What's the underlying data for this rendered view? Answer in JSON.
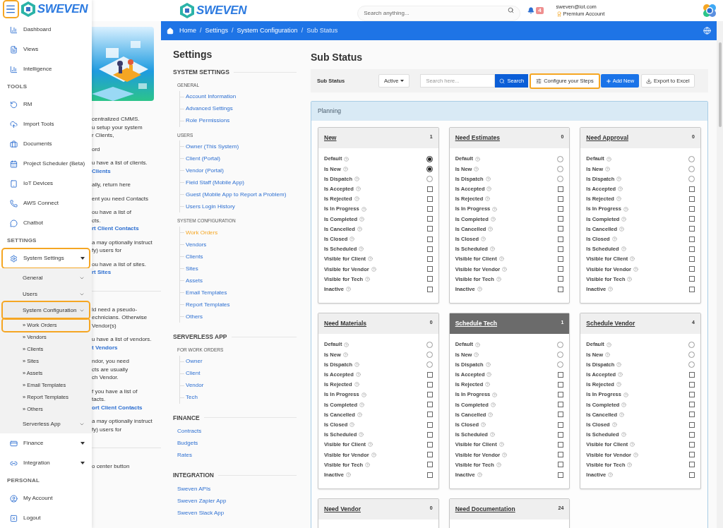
{
  "sidebar": {
    "menu_button": {
      "highlighted": true
    },
    "logo": "SWEVEN",
    "items": [
      {
        "kind": "link",
        "label": "Dashboard",
        "highlighted": false
      },
      {
        "kind": "link",
        "label": "Views",
        "highlighted": false
      },
      {
        "kind": "link",
        "label": "Intelligence",
        "highlighted": false
      },
      {
        "kind": "heading",
        "label": "TOOLS"
      },
      {
        "kind": "link",
        "label": "RM",
        "highlighted": false
      },
      {
        "kind": "link",
        "label": "Import Tools",
        "highlighted": false
      },
      {
        "kind": "link",
        "label": "Documents",
        "highlighted": false
      },
      {
        "kind": "link",
        "label": "Project Scheduler (Beta)",
        "highlighted": false
      },
      {
        "kind": "link",
        "label": "IoT Devices",
        "highlighted": false
      },
      {
        "kind": "link",
        "label": "AWS Connect",
        "highlighted": false
      },
      {
        "kind": "link",
        "label": "Chatbot",
        "highlighted": false
      },
      {
        "kind": "heading",
        "label": "SETTINGS"
      },
      {
        "kind": "group",
        "label": "System Settings",
        "highlighted": true,
        "expanded": true,
        "children": [
          {
            "kind": "group",
            "label": "General",
            "highlighted": false
          },
          {
            "kind": "group",
            "label": "Users",
            "highlighted": false
          },
          {
            "kind": "group",
            "label": "System Configuration",
            "highlighted": true,
            "expanded": true,
            "children": [
              {
                "kind": "link",
                "label": "» Work Orders",
                "highlighted": true
              },
              {
                "kind": "link",
                "label": "» Vendors",
                "highlighted": false
              },
              {
                "kind": "link",
                "label": "» Clients",
                "highlighted": false
              },
              {
                "kind": "link",
                "label": "» Sites",
                "highlighted": false
              },
              {
                "kind": "link",
                "label": "» Assets",
                "highlighted": false
              },
              {
                "kind": "link",
                "label": "» Email Templates",
                "highlighted": false
              },
              {
                "kind": "link",
                "label": "» Report Templates",
                "highlighted": false
              },
              {
                "kind": "link",
                "label": "» Others",
                "highlighted": false
              }
            ]
          },
          {
            "kind": "group",
            "label": "Serverless App",
            "highlighted": false
          }
        ]
      },
      {
        "kind": "group",
        "label": "Finance",
        "highlighted": false
      },
      {
        "kind": "group",
        "label": "Integration",
        "highlighted": false
      },
      {
        "kind": "heading",
        "label": "PERSONAL"
      },
      {
        "kind": "link",
        "label": "My Account",
        "highlighted": false
      },
      {
        "kind": "link",
        "label": "Logout",
        "highlighted": false
      }
    ]
  },
  "background_panel": {
    "sections": [
      [
        [
          {
            "kind": "text",
            "text": "centralized CMMS."
          },
          {
            "kind": "text",
            "text": "u setup your system"
          },
          {
            "kind": "text",
            "text": "r Clients,"
          }
        ],
        [
          {
            "kind": "text",
            "text": "ord"
          }
        ],
        [
          {
            "kind": "text",
            "text": "u have a list of clients."
          },
          {
            "kind": "link",
            "text": "Clients"
          }
        ],
        [
          {
            "kind": "text",
            "text": "ally, return here"
          }
        ],
        [
          {
            "kind": "text",
            "text": "ent you need Contacts"
          }
        ],
        [
          {
            "kind": "text",
            "text": "ou have a list of"
          },
          {
            "kind": "text",
            "text": "cts."
          },
          {
            "kind": "link",
            "text": "rt Client Contacts"
          }
        ],
        [
          {
            "kind": "text",
            "text": "a may optionally instruct"
          },
          {
            "kind": "text",
            "text": "fy) users for"
          }
        ],
        [
          {
            "kind": "text",
            "text": "ou have a list of sites."
          },
          {
            "kind": "link",
            "text": "rt Sites"
          }
        ]
      ],
      [
        [
          {
            "kind": "text",
            "text": "ld need a pseudo-"
          },
          {
            "kind": "text",
            "text": "echnicians. Otherwise"
          },
          {
            "kind": "text",
            "text": "Vendor(s)"
          }
        ],
        [
          {
            "kind": "text",
            "text": "u have a list of vendors."
          },
          {
            "kind": "link",
            "text": "t Vendors"
          }
        ],
        [
          {
            "kind": "text",
            "text": "ndor, you need"
          },
          {
            "kind": "text",
            "text": "cts are usually"
          },
          {
            "kind": "text",
            "text": "ch Vendor."
          }
        ],
        [
          {
            "kind": "text",
            "text": "f you have a list of"
          },
          {
            "kind": "text",
            "text": "tacts."
          },
          {
            "kind": "link",
            "text": "ort Client Contacts"
          }
        ],
        [
          {
            "kind": "text",
            "text": "a may optionally instruct"
          },
          {
            "kind": "text",
            "text": "fy) users for"
          }
        ]
      ],
      [
        [
          {
            "kind": "text",
            "text": "o center button"
          }
        ]
      ]
    ]
  },
  "header": {
    "logo": "SWEVEN",
    "search": {
      "placeholder": "Search anything..."
    },
    "notification_count": "4",
    "user_email": "sweven@iot.com",
    "account_type": "Premium Account"
  },
  "breadcrumb": {
    "separator": "/",
    "items": [
      "Home",
      "Settings",
      "System Configuration",
      "Sub Status"
    ]
  },
  "settings_nav": {
    "title": "Settings",
    "sections": [
      {
        "heading": "SYSTEM SETTINGS",
        "groups": [
          {
            "heading": "GENERAL",
            "links": [
              {
                "label": "Account Information",
                "selected": false
              },
              {
                "label": "Advanced Settings",
                "selected": false
              },
              {
                "label": "Role Permissions",
                "selected": false
              }
            ]
          },
          {
            "heading": "USERS",
            "links": [
              {
                "label": "Owner (This System)",
                "selected": false
              },
              {
                "label": "Client (Portal)",
                "selected": false
              },
              {
                "label": "Vendor (Portal)",
                "selected": false
              },
              {
                "label": "Field Staff (Mobile App)",
                "selected": false
              },
              {
                "label": "Guest (Mobile App to Report a Problem)",
                "selected": false
              },
              {
                "label": "Users Login History",
                "selected": false
              }
            ]
          },
          {
            "heading": "SYSTEM CONFIGURATION",
            "links": [
              {
                "label": "Work Orders",
                "selected": true
              },
              {
                "label": "Vendors",
                "selected": false
              },
              {
                "label": "Clients",
                "selected": false
              },
              {
                "label": "Sites",
                "selected": false
              },
              {
                "label": "Assets",
                "selected": false
              },
              {
                "label": "Email Templates",
                "selected": false
              },
              {
                "label": "Report Templates",
                "selected": false
              },
              {
                "label": "Others",
                "selected": false
              }
            ]
          }
        ]
      },
      {
        "heading": "SERVERLESS APP",
        "groups": [
          {
            "heading": "FOR WORK ORDERS",
            "links": [
              {
                "label": "Owner",
                "selected": false
              },
              {
                "label": "Client",
                "selected": false
              },
              {
                "label": "Vendor",
                "selected": false
              },
              {
                "label": "Tech",
                "selected": false
              }
            ]
          }
        ]
      },
      {
        "heading": "FINANCE",
        "groups": [
          {
            "links": [
              {
                "label": "Contracts",
                "selected": false
              },
              {
                "label": "Budgets",
                "selected": false
              },
              {
                "label": "Rates",
                "selected": false
              }
            ]
          }
        ]
      },
      {
        "heading": "INTEGRATION",
        "groups": [
          {
            "links": [
              {
                "label": "Sweven APIs",
                "selected": false
              },
              {
                "label": "Sweven Zapier App",
                "selected": false
              },
              {
                "label": "Sweven Slack App",
                "selected": false
              }
            ]
          }
        ]
      }
    ]
  },
  "page_title": "Sub Status",
  "toolbar": {
    "label": "Sub Status",
    "status_filter": "Active",
    "search": {
      "placeholder": "Search here..."
    },
    "search_button": "Search",
    "configure_button": {
      "label": "Configure your Steps",
      "highlighted": true
    },
    "add_button": "Add New",
    "export_button": "Export to Excel"
  },
  "panel": {
    "title": "Planning",
    "cards": [
      {
        "title": "New",
        "count": "1",
        "selected": false,
        "options": [
          {
            "label": "Default",
            "kind": "radio",
            "checked": true
          },
          {
            "label": "Is New",
            "kind": "radio",
            "checked": true
          },
          {
            "label": "Is Dispatch",
            "kind": "radio",
            "checked": false
          },
          {
            "label": "Is Accepted",
            "kind": "checkbox",
            "checked": false
          },
          {
            "label": "Is Rejected",
            "kind": "checkbox",
            "checked": false
          },
          {
            "label": "Is In Progress",
            "kind": "checkbox",
            "checked": false
          },
          {
            "label": "Is Completed",
            "kind": "checkbox",
            "checked": false
          },
          {
            "label": "Is Cancelled",
            "kind": "checkbox",
            "checked": false
          },
          {
            "label": "Is Closed",
            "kind": "checkbox",
            "checked": false
          },
          {
            "label": "Is Scheduled",
            "kind": "checkbox",
            "checked": false
          },
          {
            "label": "Visible for Client",
            "kind": "checkbox",
            "checked": false
          },
          {
            "label": "Visible for Vendor",
            "kind": "checkbox",
            "checked": false
          },
          {
            "label": "Visible for Tech",
            "kind": "checkbox",
            "checked": false
          },
          {
            "label": "Inactive",
            "kind": "checkbox",
            "checked": false
          }
        ]
      },
      {
        "title": "Need Estimates",
        "count": "0",
        "selected": false,
        "options": [
          {
            "label": "Default",
            "kind": "radio",
            "checked": false
          },
          {
            "label": "Is New",
            "kind": "radio",
            "checked": false
          },
          {
            "label": "Is Dispatch",
            "kind": "radio",
            "checked": false
          },
          {
            "label": "Is Accepted",
            "kind": "checkbox",
            "checked": false
          },
          {
            "label": "Is Rejected",
            "kind": "checkbox",
            "checked": false
          },
          {
            "label": "Is In Progress",
            "kind": "checkbox",
            "checked": false
          },
          {
            "label": "Is Completed",
            "kind": "checkbox",
            "checked": false
          },
          {
            "label": "Is Cancelled",
            "kind": "checkbox",
            "checked": false
          },
          {
            "label": "Is Closed",
            "kind": "checkbox",
            "checked": false
          },
          {
            "label": "Is Scheduled",
            "kind": "checkbox",
            "checked": false
          },
          {
            "label": "Visible for Client",
            "kind": "checkbox",
            "checked": false
          },
          {
            "label": "Visible for Vendor",
            "kind": "checkbox",
            "checked": false
          },
          {
            "label": "Visible for Tech",
            "kind": "checkbox",
            "checked": false
          },
          {
            "label": "Inactive",
            "kind": "checkbox",
            "checked": false
          }
        ]
      },
      {
        "title": "Need Approval",
        "count": "0",
        "selected": false,
        "options": [
          {
            "label": "Default",
            "kind": "radio",
            "checked": false
          },
          {
            "label": "Is New",
            "kind": "radio",
            "checked": false
          },
          {
            "label": "Is Dispatch",
            "kind": "radio",
            "checked": false
          },
          {
            "label": "Is Accepted",
            "kind": "checkbox",
            "checked": false
          },
          {
            "label": "Is Rejected",
            "kind": "checkbox",
            "checked": false
          },
          {
            "label": "Is In Progress",
            "kind": "checkbox",
            "checked": false
          },
          {
            "label": "Is Completed",
            "kind": "checkbox",
            "checked": false
          },
          {
            "label": "Is Cancelled",
            "kind": "checkbox",
            "checked": false
          },
          {
            "label": "Is Closed",
            "kind": "checkbox",
            "checked": false
          },
          {
            "label": "Is Scheduled",
            "kind": "checkbox",
            "checked": false
          },
          {
            "label": "Visible for Client",
            "kind": "checkbox",
            "checked": false
          },
          {
            "label": "Visible for Vendor",
            "kind": "checkbox",
            "checked": false
          },
          {
            "label": "Visible for Tech",
            "kind": "checkbox",
            "checked": false
          },
          {
            "label": "Inactive",
            "kind": "checkbox",
            "checked": false
          }
        ]
      },
      {
        "title": "Need Materials",
        "count": "0",
        "selected": false,
        "options": [
          {
            "label": "Default",
            "kind": "radio",
            "checked": false
          },
          {
            "label": "Is New",
            "kind": "radio",
            "checked": false
          },
          {
            "label": "Is Dispatch",
            "kind": "radio",
            "checked": false
          },
          {
            "label": "Is Accepted",
            "kind": "checkbox",
            "checked": false
          },
          {
            "label": "Is Rejected",
            "kind": "checkbox",
            "checked": false
          },
          {
            "label": "Is In Progress",
            "kind": "checkbox",
            "checked": false
          },
          {
            "label": "Is Completed",
            "kind": "checkbox",
            "checked": false
          },
          {
            "label": "Is Cancelled",
            "kind": "checkbox",
            "checked": false
          },
          {
            "label": "Is Closed",
            "kind": "checkbox",
            "checked": false
          },
          {
            "label": "Is Scheduled",
            "kind": "checkbox",
            "checked": false
          },
          {
            "label": "Visible for Client",
            "kind": "checkbox",
            "checked": false
          },
          {
            "label": "Visible for Vendor",
            "kind": "checkbox",
            "checked": false
          },
          {
            "label": "Visible for Tech",
            "kind": "checkbox",
            "checked": false
          },
          {
            "label": "Inactive",
            "kind": "checkbox",
            "checked": false
          }
        ]
      },
      {
        "title": "Schedule Tech",
        "count": "1",
        "selected": true,
        "options": [
          {
            "label": "Default",
            "kind": "radio",
            "checked": false
          },
          {
            "label": "Is New",
            "kind": "radio",
            "checked": false
          },
          {
            "label": "Is Dispatch",
            "kind": "radio",
            "checked": false
          },
          {
            "label": "Is Accepted",
            "kind": "checkbox",
            "checked": false
          },
          {
            "label": "Is Rejected",
            "kind": "checkbox",
            "checked": false
          },
          {
            "label": "Is In Progress",
            "kind": "checkbox",
            "checked": false
          },
          {
            "label": "Is Completed",
            "kind": "checkbox",
            "checked": false
          },
          {
            "label": "Is Cancelled",
            "kind": "checkbox",
            "checked": false
          },
          {
            "label": "Is Closed",
            "kind": "checkbox",
            "checked": false
          },
          {
            "label": "Is Scheduled",
            "kind": "checkbox",
            "checked": false
          },
          {
            "label": "Visible for Client",
            "kind": "checkbox",
            "checked": false
          },
          {
            "label": "Visible for Vendor",
            "kind": "checkbox",
            "checked": false
          },
          {
            "label": "Visible for Tech",
            "kind": "checkbox",
            "checked": false
          },
          {
            "label": "Inactive",
            "kind": "checkbox",
            "checked": false
          }
        ]
      },
      {
        "title": "Schedule Vendor",
        "count": "4",
        "selected": false,
        "options": [
          {
            "label": "Default",
            "kind": "radio",
            "checked": false
          },
          {
            "label": "Is New",
            "kind": "radio",
            "checked": false
          },
          {
            "label": "Is Dispatch",
            "kind": "radio",
            "checked": false
          },
          {
            "label": "Is Accepted",
            "kind": "checkbox",
            "checked": false
          },
          {
            "label": "Is Rejected",
            "kind": "checkbox",
            "checked": false
          },
          {
            "label": "Is In Progress",
            "kind": "checkbox",
            "checked": false
          },
          {
            "label": "Is Completed",
            "kind": "checkbox",
            "checked": false
          },
          {
            "label": "Is Cancelled",
            "kind": "checkbox",
            "checked": false
          },
          {
            "label": "Is Closed",
            "kind": "checkbox",
            "checked": false
          },
          {
            "label": "Is Scheduled",
            "kind": "checkbox",
            "checked": false
          },
          {
            "label": "Visible for Client",
            "kind": "checkbox",
            "checked": false
          },
          {
            "label": "Visible for Vendor",
            "kind": "checkbox",
            "checked": false
          },
          {
            "label": "Visible for Tech",
            "kind": "checkbox",
            "checked": false
          },
          {
            "label": "Inactive",
            "kind": "checkbox",
            "checked": false
          }
        ]
      },
      {
        "title": "Need Vendor",
        "count": "0",
        "selected": false
      },
      {
        "title": "Need Documentation",
        "count": "24",
        "selected": false
      }
    ]
  }
}
